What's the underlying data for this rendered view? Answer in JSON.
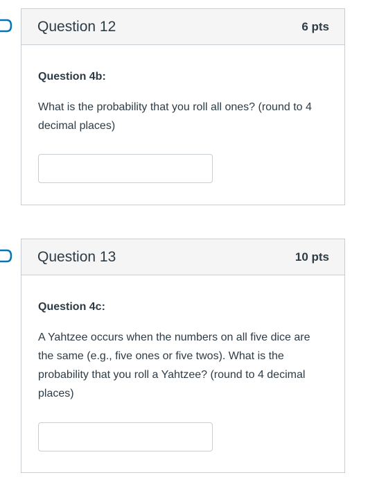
{
  "questions": [
    {
      "title": "Question 12",
      "points": "6 pts",
      "subtitle": "Question 4b:",
      "text": "What is the probability that you roll all ones? (round to 4 decimal places)",
      "answer_value": ""
    },
    {
      "title": "Question 13",
      "points": "10 pts",
      "subtitle": "Question 4c:",
      "text": "A Yahtzee occurs when the numbers on all five dice are the same (e.g., five ones or five twos). What is the probability that you roll a Yahtzee? (round to 4 decimal places)",
      "answer_value": ""
    }
  ],
  "colors": {
    "border": "#c7cdd1",
    "header_bg": "#f5f5f5",
    "text": "#2d3b45",
    "flag": "#0374b5"
  },
  "icons": {
    "flag": "bookmark-flag-icon"
  }
}
